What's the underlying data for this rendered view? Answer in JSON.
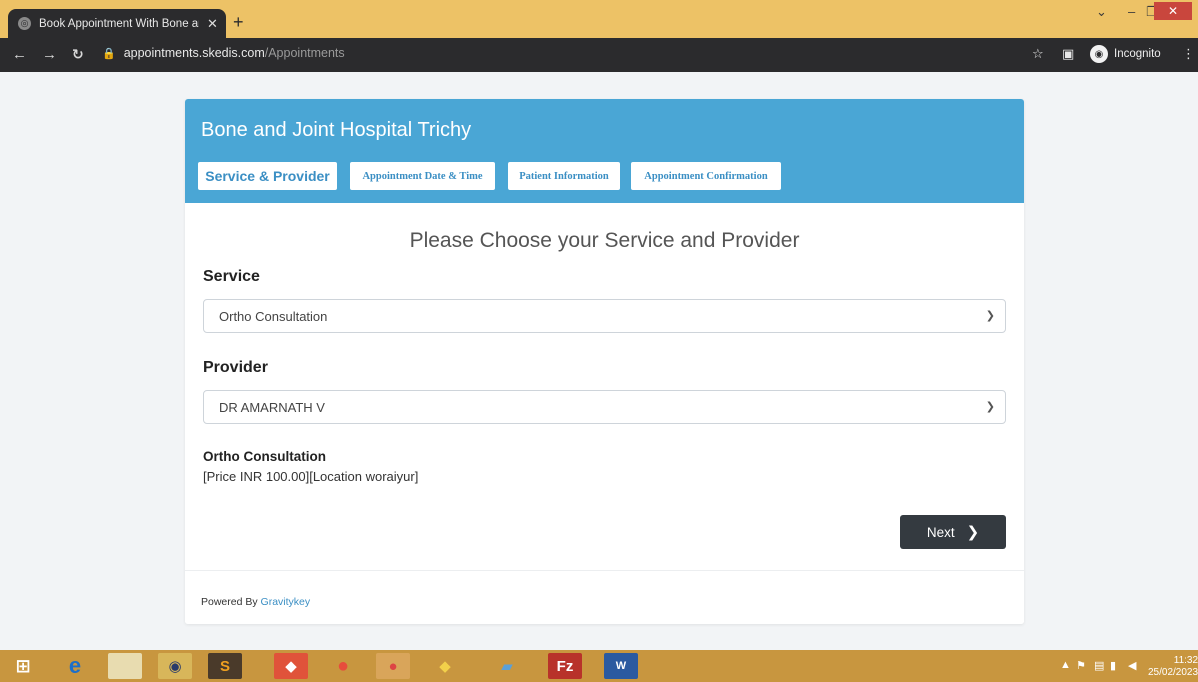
{
  "browser": {
    "tab_title": "Book Appointment With Bone and Joint Hospital Trichy",
    "url_domain": "appointments.skedis.com",
    "url_path": "/Appointments",
    "incognito_label": "Incognito"
  },
  "page": {
    "hospital_name": "Bone and Joint Hospital Trichy",
    "steps": [
      {
        "label": "Service & Provider"
      },
      {
        "label": "Appointment Date & Time"
      },
      {
        "label": "Patient Information"
      },
      {
        "label": "Appointment Confirmation"
      }
    ],
    "heading": "Please Choose your Service and Provider",
    "service_label": "Service",
    "service_value": "Ortho Consultation",
    "provider_label": "Provider",
    "provider_value": "DR AMARNATH V",
    "summary_title": "Ortho Consultation",
    "summary_detail": "[Price INR 100.00][Location woraiyur]",
    "next_label": "Next",
    "footer_prefix": "Powered By",
    "footer_brand": "Gravitykey"
  },
  "taskbar": {
    "time": "11:32",
    "date": "25/02/2023"
  },
  "colors": {
    "header_blue": "#4aa6d5",
    "next_button": "#343a40",
    "taskbar": "#c8963f"
  }
}
